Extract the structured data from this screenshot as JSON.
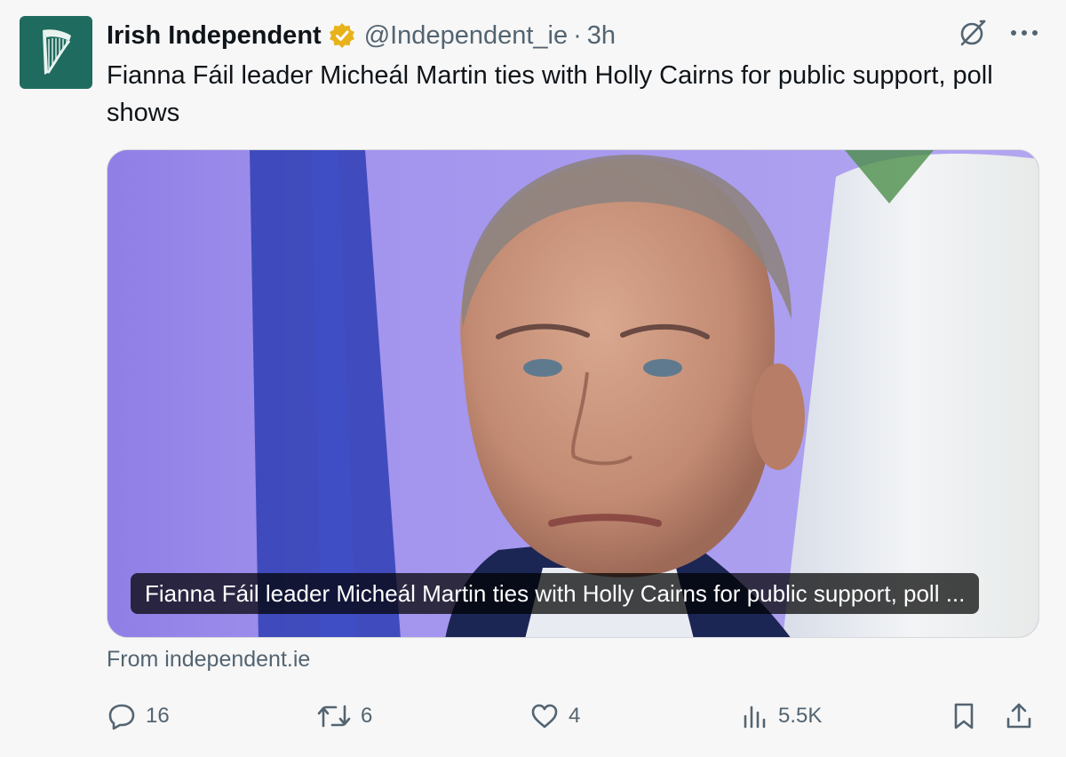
{
  "author": {
    "name": "Irish Independent",
    "handle": "@Independent_ie",
    "separator": "·",
    "time": "3h",
    "avatar_icon": "harp-logo-icon",
    "verified_icon": "verified-badge-icon",
    "verified_color": "#e8b21a"
  },
  "top_icons": [
    "grok-icon",
    "more-icon"
  ],
  "tweet_text": "Fianna Fáil leader Micheál Martin ties with Holly Cairns for public support, poll shows",
  "card": {
    "caption": "Fianna Fáil leader Micheál Martin ties with Holly Cairns for public support, poll ...",
    "source": "From independent.ie"
  },
  "actions": {
    "reply": {
      "icon": "reply-icon",
      "count": "16"
    },
    "retweet": {
      "icon": "retweet-icon",
      "count": "6"
    },
    "like": {
      "icon": "heart-icon",
      "count": "4"
    },
    "views": {
      "icon": "analytics-icon",
      "count": "5.5K"
    },
    "bookmark": {
      "icon": "bookmark-icon"
    },
    "share": {
      "icon": "share-icon"
    }
  },
  "colors": {
    "text": "#0f1419",
    "muted": "#536471",
    "avatar_bg": "#1f6b5f"
  }
}
